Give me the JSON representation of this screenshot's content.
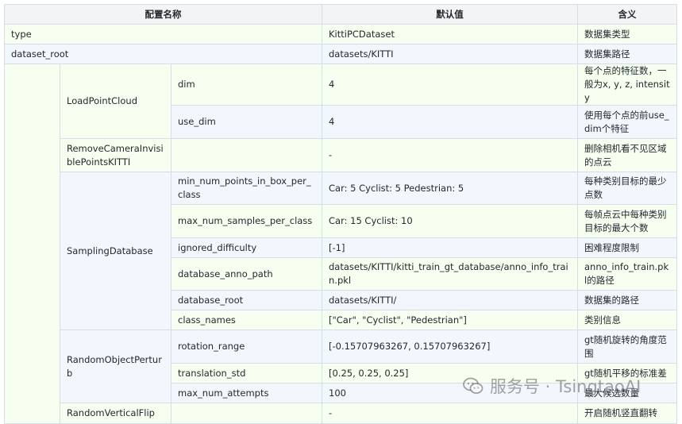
{
  "header": {
    "name": "配置名称",
    "default": "默认值",
    "meaning": "含义"
  },
  "rows": {
    "type": {
      "name": "type",
      "default": "KittiPCDataset",
      "meaning": "数据集类型"
    },
    "dataset_root": {
      "name": "dataset_root",
      "default": "datasets/KITTI",
      "meaning": "数据集路径"
    },
    "load_point_cloud": {
      "name": "LoadPointCloud",
      "dim": {
        "name": "dim",
        "default": "4",
        "meaning": "每个点的特征数，一般为x, y, z, intensity"
      },
      "use_dim": {
        "name": "use_dim",
        "default": "4",
        "meaning": "使用每个点的前use_dim个特征"
      }
    },
    "remove_camera": {
      "name": "RemoveCameraInvisiblePointsKITTI",
      "default": "-",
      "meaning": "删除相机看不见区域的点云"
    },
    "sampling_database": {
      "name": "SamplingDatabase",
      "min_num_points": {
        "name": "min_num_points_in_box_per_class",
        "default": "Car: 5 Cyclist: 5 Pedestrian: 5",
        "meaning": "每种类别目标的最少点数"
      },
      "max_num_samples": {
        "name": "max_num_samples_per_class",
        "default": "Car: 15 Cyclist: 10",
        "meaning": "每帧点云中每种类别目标的最大个数"
      },
      "ignored_difficulty": {
        "name": "ignored_difficulty",
        "default": "[-1]",
        "meaning": "困难程度限制"
      },
      "database_anno_path": {
        "name": "database_anno_path",
        "default": "datasets/KITTI/kitti_train_gt_database/anno_info_train.pkl",
        "meaning": "anno_info_train.pkl的路径"
      },
      "database_root": {
        "name": "database_root",
        "default": "datasets/KITTI/",
        "meaning": "数据集的路径"
      },
      "class_names": {
        "name": "class_names",
        "default": "[\"Car\", \"Cyclist\", \"Pedestrian\"]",
        "meaning": "类别信息"
      }
    },
    "random_object_perturb": {
      "name": "RandomObjectPerturb",
      "rotation_range": {
        "name": "rotation_range",
        "default": "[-0.15707963267, 0.15707963267]",
        "meaning": "gt随机旋转的角度范围"
      },
      "translation_std": {
        "name": "translation_std",
        "default": "[0.25, 0.25, 0.25]",
        "meaning": "gt随机平移的标准差"
      },
      "max_num_attempts": {
        "name": "max_num_attempts",
        "default": "100",
        "meaning": "最大候选数量"
      }
    },
    "random_vertical_flip": {
      "name": "RandomVerticalFlip",
      "default": "-",
      "meaning": "开启随机竖直翻转"
    }
  },
  "watermark": {
    "text": "服务号 · TsingtaoAI",
    "icon": "wechat-icon"
  }
}
